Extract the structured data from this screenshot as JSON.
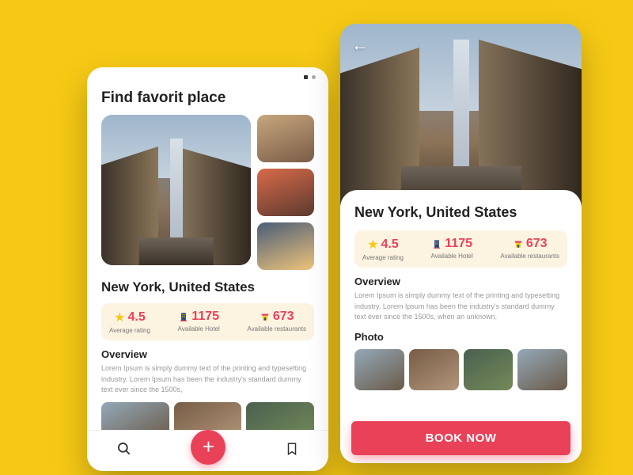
{
  "left": {
    "page_title": "Find favorit place",
    "place_name": "New York, United States",
    "stats": {
      "rating": {
        "value": "4.5",
        "label": "Average rating"
      },
      "hotels": {
        "value": "1175",
        "label": "Available Hotel"
      },
      "restaurants": {
        "value": "673",
        "label": "Available restaurants"
      }
    },
    "overview": {
      "title": "Overview",
      "text": "Lorem Ipsum is simply dummy text of the printing and typesetting industry. Lorem Ipsum has been the industry's standard dummy text ever since the 1500s,"
    }
  },
  "right": {
    "place_name": "New York, United States",
    "stats": {
      "rating": {
        "value": "4.5",
        "label": "Average rating"
      },
      "hotels": {
        "value": "1175",
        "label": "Available Hotel"
      },
      "restaurants": {
        "value": "673",
        "label": "Available restaurants"
      }
    },
    "overview": {
      "title": "Overview",
      "text": "Lorem Ipsum is simply dummy text of the printing and typesetting industry. Lorem Ipsum has been the industry's standard dummy text ever since the 1500s, when an unknown."
    },
    "photo_title": "Photo",
    "cta": "BOOK NOW"
  }
}
